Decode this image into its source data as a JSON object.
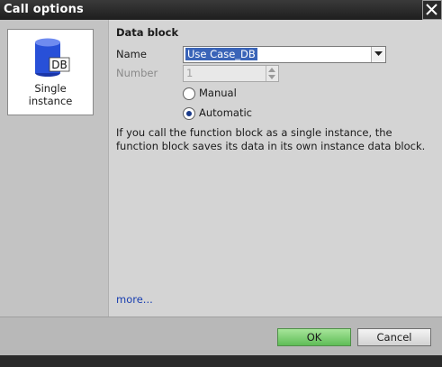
{
  "window": {
    "title": "Call options"
  },
  "left_panel": {
    "tile_icon_text": "DB",
    "tile_label": "Single\ninstance"
  },
  "data_block": {
    "section_title": "Data block",
    "name_label": "Name",
    "name_value": "Use Case_DB",
    "number_label": "Number",
    "number_value": "1",
    "options": [
      {
        "label": "Manual",
        "selected": false
      },
      {
        "label": "Automatic",
        "selected": true
      }
    ],
    "description": "If you call the function block as a single instance, the function block saves its data in its own instance data block.",
    "more_link": "more..."
  },
  "buttons": {
    "ok": "OK",
    "cancel": "Cancel"
  },
  "colors": {
    "accent_selection": "#3a64b8",
    "ok_button": "#5fbd57",
    "db_icon": "#2850d8"
  },
  "icons": {
    "close": "close-icon",
    "dropdown": "chevron-down-icon",
    "spinner": "spinner-arrows-icon",
    "db": "database-icon"
  }
}
